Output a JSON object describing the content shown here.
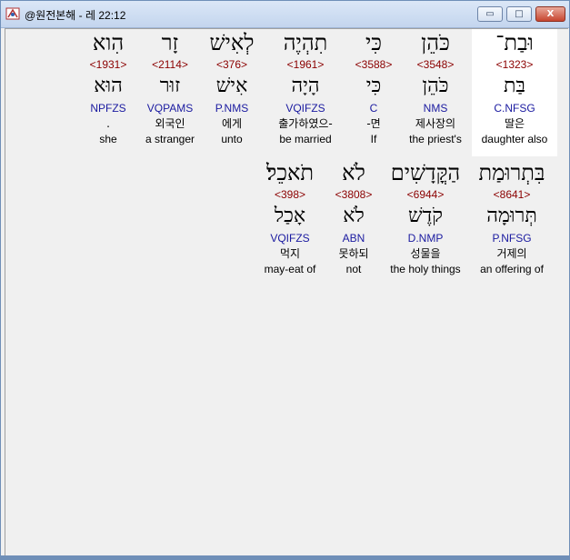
{
  "window": {
    "title": "@원전본해 - 레 22:12",
    "buttons": {
      "minimize": "▭",
      "maximize": "□",
      "close": "X"
    }
  },
  "rows": [
    {
      "words": [
        {
          "hebrew": "וּבַת־",
          "strong": "<1323>",
          "lemma": "בַּת",
          "parse": "C.NFSG",
          "korean": "딸은",
          "english": "daughter also",
          "highlight": true
        },
        {
          "hebrew": "כֹּהֵן",
          "strong": "<3548>",
          "lemma": "כֹּהֵן",
          "parse": "NMS",
          "korean": "제사장의",
          "english": "the priest's",
          "highlight": false
        },
        {
          "hebrew": "כִּי",
          "strong": "<3588>",
          "lemma": "כִּי",
          "parse": "C",
          "korean": "-면",
          "english": "If",
          "highlight": false
        },
        {
          "hebrew": "תִהְיֶה",
          "strong": "<1961>",
          "lemma": "הָיָה",
          "parse": "VQIFZS",
          "korean": "출가하였으-",
          "english": "be married",
          "highlight": false
        },
        {
          "hebrew": "לְאִישׁ",
          "strong": "<376>",
          "lemma": "אִישׁ",
          "parse": "P.NMS",
          "korean": "에게",
          "english": "unto",
          "highlight": false
        },
        {
          "hebrew": "זָר",
          "strong": "<2114>",
          "lemma": "זוּר",
          "parse": "VQPAMS",
          "korean": "외국인",
          "english": "a stranger",
          "highlight": false
        },
        {
          "hebrew": "הִוא",
          "strong": "<1931>",
          "lemma": "הוּא",
          "parse": "NPFZS",
          "korean": ".",
          "english": "she",
          "highlight": false
        }
      ]
    },
    {
      "words": [
        {
          "hebrew": "בִּתְרוּמַת",
          "strong": "<8641>",
          "lemma": "תְּרוּמָה",
          "parse": "P.NFSG",
          "korean": "거제의",
          "english": "an offering of",
          "highlight": false
        },
        {
          "hebrew": "הַקֳּדָשִׁים",
          "strong": "<6944>",
          "lemma": "קֹדֶשׁ",
          "parse": "D.NMP",
          "korean": "성물을",
          "english": "the holy things",
          "highlight": false
        },
        {
          "hebrew": "לֹא",
          "strong": "<3808>",
          "lemma": "לֹא",
          "parse": "ABN",
          "korean": "못하되",
          "english": "not",
          "highlight": false
        },
        {
          "hebrew": "תֹאכֵל׃",
          "strong": "<398>",
          "lemma": "אָכַל",
          "parse": "VQIFZS",
          "korean": "먹지",
          "english": "may-eat of",
          "highlight": false
        }
      ]
    }
  ]
}
